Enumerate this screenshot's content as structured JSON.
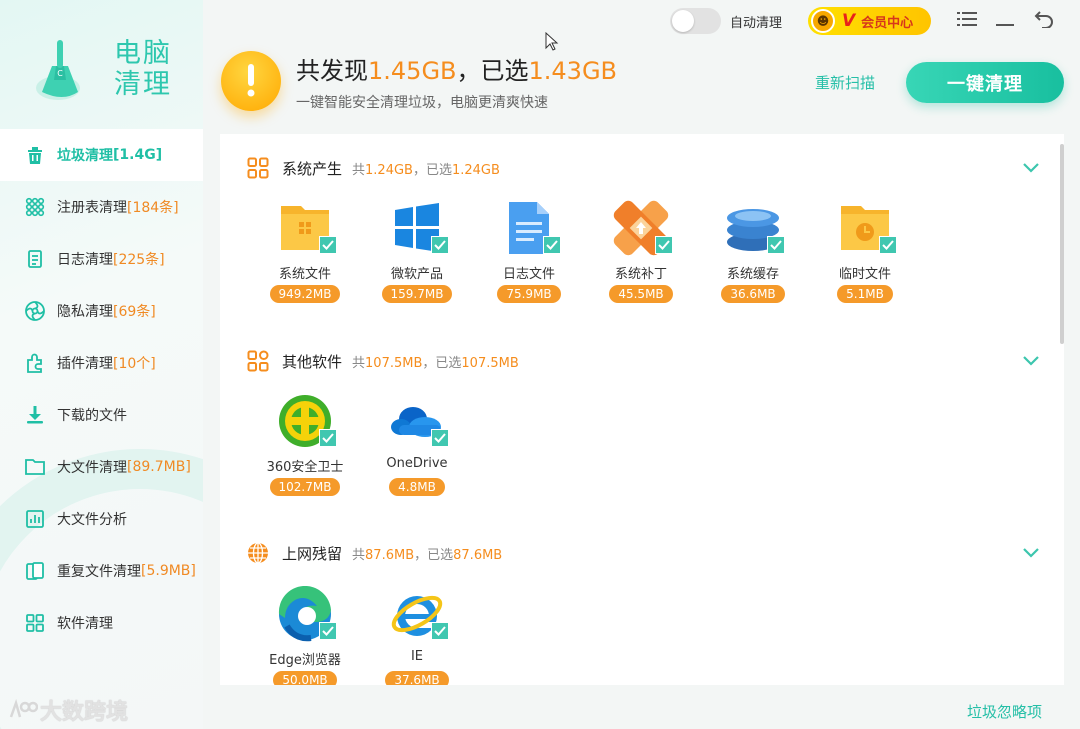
{
  "app": {
    "logo_text": "电脑清理",
    "watermark": "大数跨境"
  },
  "topbar": {
    "auto_clean_label": "自动清理",
    "auto_clean_on": false,
    "vip_label": "会员中心",
    "vip_v": "V"
  },
  "header": {
    "prefix": "共发现",
    "found": "1.45GB",
    "sep": "，已选",
    "selected": "1.43GB",
    "subtitle": "一键智能安全清理垃圾，电脑更清爽快速",
    "rescan_label": "重新扫描",
    "clean_label": "一键清理"
  },
  "sidebar": {
    "items": [
      {
        "label": "垃圾清理",
        "count": "[1.4G]",
        "icon": "trash-icon",
        "active": true
      },
      {
        "label": "注册表清理",
        "count": "[184条]",
        "icon": "registry-icon"
      },
      {
        "label": "日志清理",
        "count": "[225条]",
        "icon": "log-icon"
      },
      {
        "label": "隐私清理",
        "count": "[69条]",
        "icon": "privacy-icon"
      },
      {
        "label": "插件清理",
        "count": "[10个]",
        "icon": "plugin-icon"
      },
      {
        "label": "下载的文件",
        "count": "",
        "icon": "download-icon"
      },
      {
        "label": "大文件清理",
        "count": "[89.7MB]",
        "icon": "folder-icon"
      },
      {
        "label": "大文件分析",
        "count": "",
        "icon": "chart-icon"
      },
      {
        "label": "重复文件清理",
        "count": "[5.9MB]",
        "icon": "duplicate-icon"
      },
      {
        "label": "软件清理",
        "count": "",
        "icon": "apps-icon"
      }
    ]
  },
  "sections": [
    {
      "title": "系统产生",
      "total_prefix": "共",
      "total": "1.24GB",
      "sel_prefix": "，已选",
      "selected": "1.24GB",
      "items": [
        {
          "label": "系统文件",
          "size": "949.2MB",
          "icon": "system-files-icon"
        },
        {
          "label": "微软产品",
          "size": "159.7MB",
          "icon": "windows-icon"
        },
        {
          "label": "日志文件",
          "size": "75.9MB",
          "icon": "log-file-icon"
        },
        {
          "label": "系统补丁",
          "size": "45.5MB",
          "icon": "patch-icon"
        },
        {
          "label": "系统缓存",
          "size": "36.6MB",
          "icon": "cache-icon"
        },
        {
          "label": "临时文件",
          "size": "5.1MB",
          "icon": "temp-file-icon"
        }
      ]
    },
    {
      "title": "其他软件",
      "total_prefix": "共",
      "total": "107.5MB",
      "sel_prefix": "，已选",
      "selected": "107.5MB",
      "items": [
        {
          "label": "360安全卫士",
          "size": "102.7MB",
          "icon": "360-icon"
        },
        {
          "label": "OneDrive",
          "size": "4.8MB",
          "icon": "onedrive-icon"
        }
      ]
    },
    {
      "title": "上网残留",
      "total_prefix": "共",
      "total": "87.6MB",
      "sel_prefix": "，已选",
      "selected": "87.6MB",
      "items": [
        {
          "label": "Edge浏览器",
          "size": "50.0MB",
          "icon": "edge-icon"
        },
        {
          "label": "IE",
          "size": "37.6MB",
          "icon": "ie-icon"
        }
      ]
    }
  ],
  "footer": {
    "ignore_label": "垃圾忽略项"
  },
  "colors": {
    "accent": "#25bfa7",
    "orange": "#f58d1e"
  }
}
